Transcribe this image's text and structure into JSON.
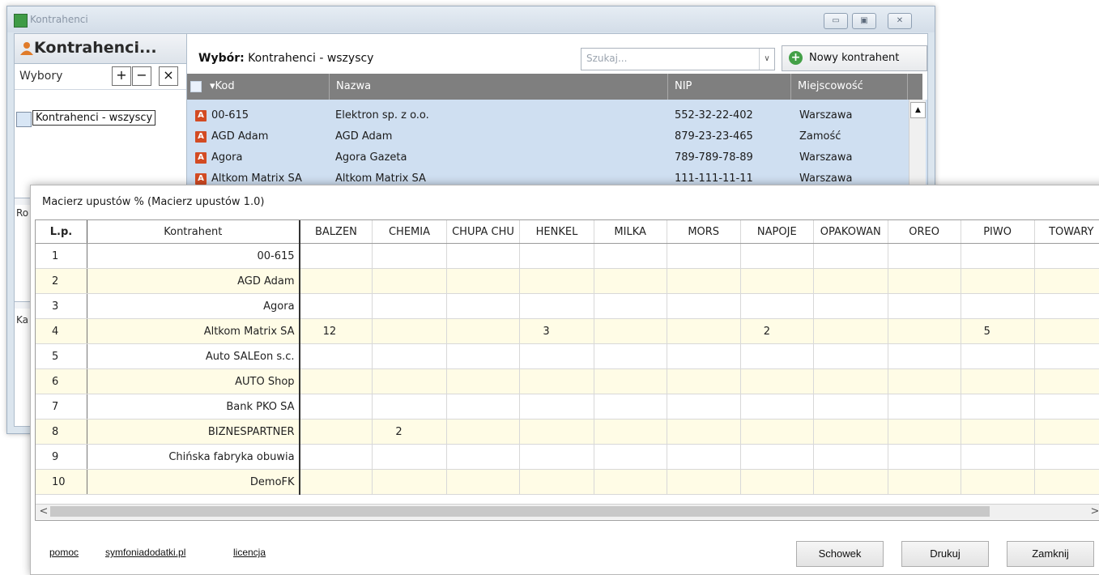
{
  "back_window": {
    "title": "Kontrahenci",
    "controls": {
      "minimize": "▭",
      "maximize": "▣",
      "close": "✕"
    },
    "left_panel": {
      "header": "Kontrahenci...",
      "wybory_label": "Wybory",
      "add": "+",
      "remove": "−",
      "delete": "×",
      "selection_item": "Kontrahenci - wszyscy",
      "section2_label": "Ro",
      "section3_label": "Ka"
    },
    "main": {
      "wybor_label": "Wybór:",
      "wybor_value": "Kontrahenci - wszyscy",
      "search_placeholder": "Szukaj...",
      "search_arrow": "∨",
      "new_button": "Nowy kontrahent",
      "new_icon": "+",
      "columns": [
        "▾Kod",
        "Nazwa",
        "NIP",
        "Miejscowość"
      ],
      "rows": [
        {
          "badge": "A",
          "kod": "00-615",
          "nazwa": "Elektron sp. z o.o.",
          "nip": "552-32-22-402",
          "miejscowosc": "Warszawa"
        },
        {
          "badge": "A",
          "kod": "AGD Adam",
          "nazwa": "AGD Adam",
          "nip": "879-23-23-465",
          "miejscowosc": "Zamość"
        },
        {
          "badge": "A",
          "kod": "Agora",
          "nazwa": "Agora Gazeta",
          "nip": "789-789-78-89",
          "miejscowosc": "Warszawa"
        },
        {
          "badge": "A",
          "kod": "Altkom Matrix SA",
          "nazwa": "Altkom Matrix SA",
          "nip": "111-111-11-11",
          "miejscowosc": "Warszawa"
        }
      ],
      "scroll_up": "▲"
    }
  },
  "dialog": {
    "title": "Macierz upustów % (Macierz upustów 1.0)",
    "columns": [
      "L.p.",
      "Kontrahent",
      "BALZEN",
      "CHEMIA",
      "CHUPA CHU",
      "HENKEL",
      "MILKA",
      "MORS",
      "NAPOJE",
      "OPAKOWAN",
      "OREO",
      "PIWO",
      "TOWARY"
    ],
    "rows": [
      {
        "lp": "1",
        "kontrahent": "00-615",
        "values": [
          "",
          "",
          "",
          "",
          "",
          "",
          "",
          "",
          "",
          "",
          ""
        ]
      },
      {
        "lp": "2",
        "kontrahent": "AGD Adam",
        "values": [
          "",
          "",
          "",
          "",
          "",
          "",
          "",
          "",
          "",
          "",
          ""
        ]
      },
      {
        "lp": "3",
        "kontrahent": "Agora",
        "values": [
          "",
          "",
          "",
          "",
          "",
          "",
          "",
          "",
          "",
          "",
          ""
        ]
      },
      {
        "lp": "4",
        "kontrahent": "Altkom Matrix SA",
        "values": [
          "12",
          "",
          "",
          "3",
          "",
          "",
          "2",
          "",
          "",
          "5",
          ""
        ]
      },
      {
        "lp": "5",
        "kontrahent": "Auto SALEon s.c.",
        "values": [
          "",
          "",
          "",
          "",
          "",
          "",
          "",
          "",
          "",
          "",
          ""
        ]
      },
      {
        "lp": "6",
        "kontrahent": "AUTO Shop",
        "values": [
          "",
          "",
          "",
          "",
          "",
          "",
          "",
          "",
          "",
          "",
          ""
        ]
      },
      {
        "lp": "7",
        "kontrahent": "Bank PKO SA",
        "values": [
          "",
          "",
          "",
          "",
          "",
          "",
          "",
          "",
          "",
          "",
          ""
        ]
      },
      {
        "lp": "8",
        "kontrahent": "BIZNESPARTNER",
        "values": [
          "",
          "2",
          "",
          "",
          "",
          "",
          "",
          "",
          "",
          "",
          ""
        ]
      },
      {
        "lp": "9",
        "kontrahent": "Chińska fabryka obuwia",
        "values": [
          "",
          "",
          "",
          "",
          "",
          "",
          "",
          "",
          "",
          "",
          ""
        ]
      },
      {
        "lp": "10",
        "kontrahent": "DemoFK",
        "values": [
          "",
          "",
          "",
          "",
          "",
          "",
          "",
          "",
          "",
          "",
          ""
        ]
      }
    ],
    "scroll_left": "<",
    "scroll_right": ">",
    "links": {
      "help": "pomoc",
      "site": "symfoniadodatki.pl",
      "license": "licencja"
    },
    "buttons": {
      "clipboard": "Schowek",
      "print": "Drukuj",
      "close": "Zamknij"
    }
  }
}
